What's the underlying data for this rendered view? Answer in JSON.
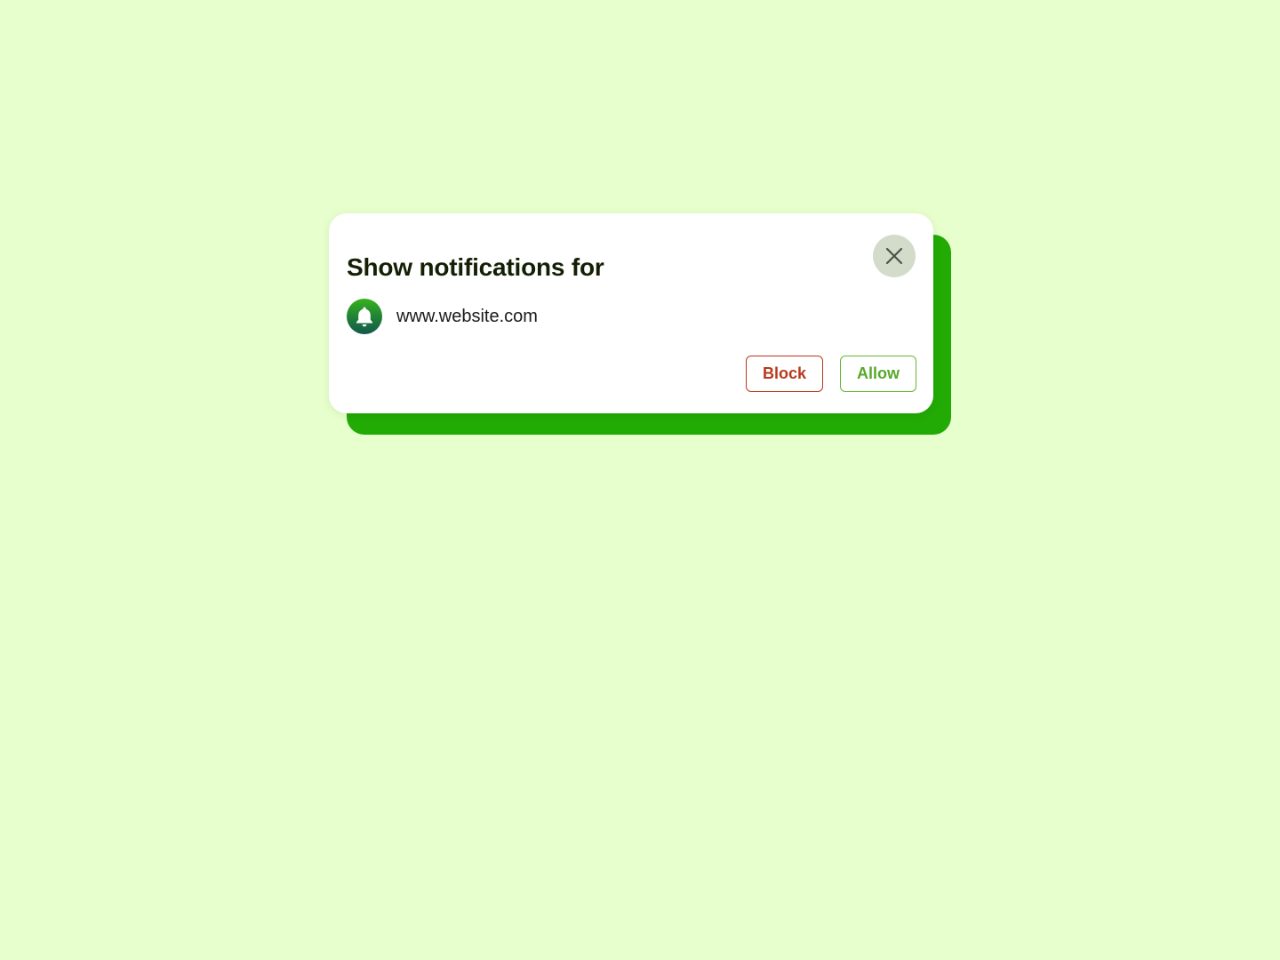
{
  "dialog": {
    "title": "Show notifications for",
    "site_url": "www.website.com",
    "site_icon": "bell-icon",
    "close_icon": "close-icon",
    "block_label": "Block",
    "allow_label": "Allow"
  },
  "colors": {
    "background": "#e6ffcd",
    "accent_shadow": "#22aa05",
    "block": "#b8391d",
    "allow": "#57a82a",
    "close_bg": "#d3dccb"
  }
}
